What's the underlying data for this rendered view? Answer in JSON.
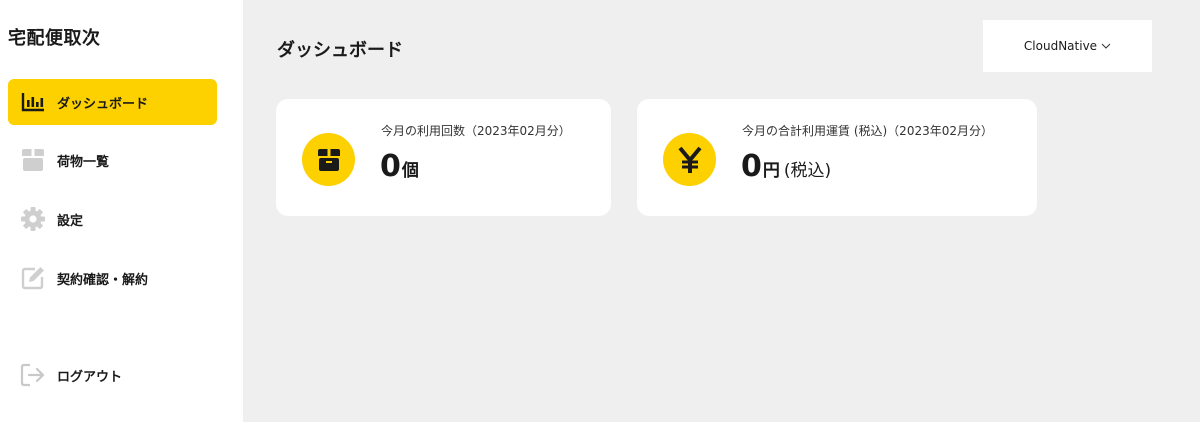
{
  "app": {
    "title": "宅配便取次"
  },
  "sidebar": {
    "items": [
      {
        "label": "ダッシュボード",
        "icon": "bar-chart-icon",
        "active": true
      },
      {
        "label": "荷物一覧",
        "icon": "package-box-icon",
        "active": false
      },
      {
        "label": "設定",
        "icon": "gear-icon",
        "active": false
      },
      {
        "label": "契約確認・解約",
        "icon": "edit-icon",
        "active": false
      }
    ],
    "logout": {
      "label": "ログアウト",
      "icon": "logout-icon"
    }
  },
  "header": {
    "title": "ダッシュボード",
    "account": {
      "label": "CloudNative"
    }
  },
  "cards": [
    {
      "label": "今月の利用回数（2023年02月分）",
      "value": "0",
      "unit": "個",
      "suffix": "",
      "icon": "package-icon"
    },
    {
      "label": "今月の合計利用運賃 (税込)（2023年02月分）",
      "value": "0",
      "unit": "円",
      "suffix": "(税込)",
      "icon": "yen-icon"
    }
  ],
  "colors": {
    "accent": "#fdd000",
    "background": "#efefef",
    "surface": "#ffffff",
    "muted_icon": "#c9c9c9"
  }
}
